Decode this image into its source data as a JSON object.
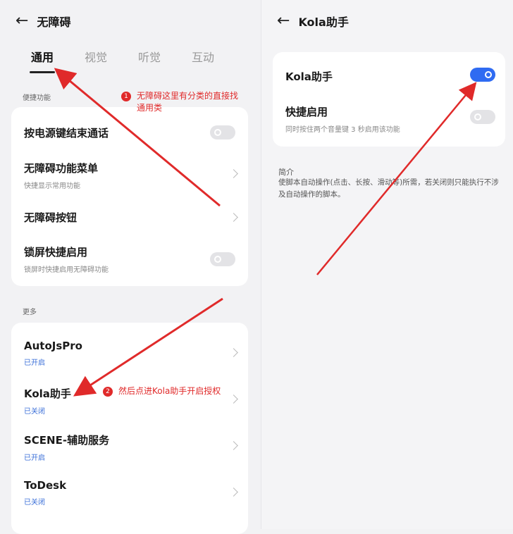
{
  "left": {
    "title": "无障碍",
    "tabs": [
      {
        "label": "通用",
        "active": true
      },
      {
        "label": "视觉",
        "active": false
      },
      {
        "label": "听觉",
        "active": false
      },
      {
        "label": "互动",
        "active": false
      }
    ],
    "section1": {
      "label": "便捷功能",
      "items": [
        {
          "title": "按电源键结束通话",
          "control": "toggle",
          "on": false
        },
        {
          "title": "无障碍功能菜单",
          "subtitle": "快捷显示常用功能",
          "control": "chevron"
        },
        {
          "title": "无障碍按钮",
          "control": "chevron"
        },
        {
          "title": "锁屏快捷启用",
          "subtitle": "锁屏时快捷启用无障碍功能",
          "control": "toggle",
          "on": false
        }
      ]
    },
    "section2": {
      "label": "更多",
      "items": [
        {
          "title": "AutoJsPro",
          "status": "已开启"
        },
        {
          "title": "Kola助手",
          "status": "已关闭"
        },
        {
          "title": "SCENE-辅助服务",
          "status": "已开启"
        },
        {
          "title": "ToDesk",
          "status": "已关闭"
        }
      ]
    }
  },
  "right": {
    "title": "Kola助手",
    "items": [
      {
        "title": "Kola助手",
        "control": "toggle",
        "on": true
      },
      {
        "title": "快捷启用",
        "subtitle": "同时按住两个音量键 3 秒启用该功能",
        "control": "toggle",
        "on": false
      }
    ],
    "intro_title": "简介",
    "intro_text": "使脚本自动操作(点击、长按、滑动等)所需，若关闭则只能执行不涉及自动操作的脚本。"
  },
  "annotations": [
    {
      "number": "1",
      "text": "无障碍这里有分类的直接找",
      "text2": "通用类"
    },
    {
      "number": "2",
      "text": "然后点进Kola助手开启授权"
    }
  ],
  "colors": {
    "accent": "#2f6bf2",
    "status": "#3b6fd8",
    "annotation": "#e02a2a",
    "background": "#f2f2f4"
  }
}
